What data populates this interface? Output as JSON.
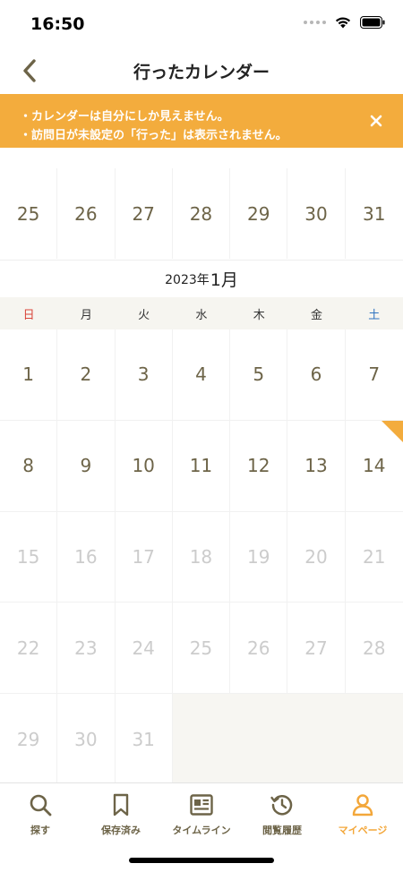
{
  "status_bar": {
    "time": "16:50"
  },
  "nav": {
    "title": "行ったカレンダー"
  },
  "banner": {
    "lines": [
      "・カレンダーは自分にしか見えません。",
      "・訪問日が未設定の「行った」は表示されません。"
    ]
  },
  "prev_month_days": [
    "25",
    "26",
    "27",
    "28",
    "29",
    "30",
    "31"
  ],
  "month": {
    "year": "2023年",
    "month": "1月"
  },
  "weekdays": [
    "日",
    "月",
    "火",
    "水",
    "木",
    "金",
    "土"
  ],
  "days": [
    "1",
    "2",
    "3",
    "4",
    "5",
    "6",
    "7",
    "8",
    "9",
    "10",
    "11",
    "12",
    "13",
    "14",
    "15",
    "16",
    "17",
    "18",
    "19",
    "20",
    "21",
    "22",
    "23",
    "24",
    "25",
    "26",
    "27",
    "28",
    "29",
    "30",
    "31"
  ],
  "tabs": [
    {
      "label": "探す",
      "icon": "search-icon"
    },
    {
      "label": "保存済み",
      "icon": "bookmark-icon"
    },
    {
      "label": "タイムライン",
      "icon": "newspaper-icon"
    },
    {
      "label": "閲覧履歴",
      "icon": "history-icon"
    },
    {
      "label": "マイページ",
      "icon": "person-icon"
    }
  ],
  "colors": {
    "accent": "#f3ac3d",
    "day_text": "#6d6448",
    "future_day_text": "#cccccc",
    "sunday": "#d9453a",
    "saturday": "#2f74c0"
  }
}
